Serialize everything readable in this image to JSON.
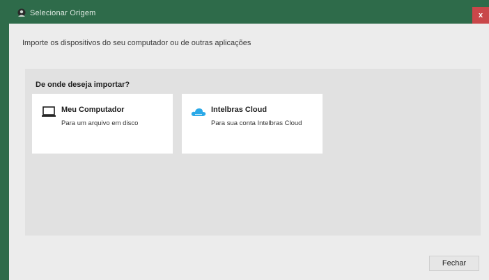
{
  "window": {
    "title": "Selecionar Origem",
    "close_glyph": "x",
    "app_icon": "app-logo-icon",
    "title_bar_color": "#2e6b4a",
    "close_color": "#c9474a"
  },
  "content": {
    "subtitle": "Importe os dispositivos do seu computador ou de outras aplicações",
    "heading": "De onde deseja importar?"
  },
  "options": [
    {
      "title": "Meu Computador",
      "description": "Para um arquivo em disco",
      "icon": "laptop-icon"
    },
    {
      "title": "Intelbras Cloud",
      "description": "Para sua conta Intelbras Cloud",
      "icon": "cloud-icon"
    }
  ],
  "footer": {
    "close_label": "Fechar"
  }
}
